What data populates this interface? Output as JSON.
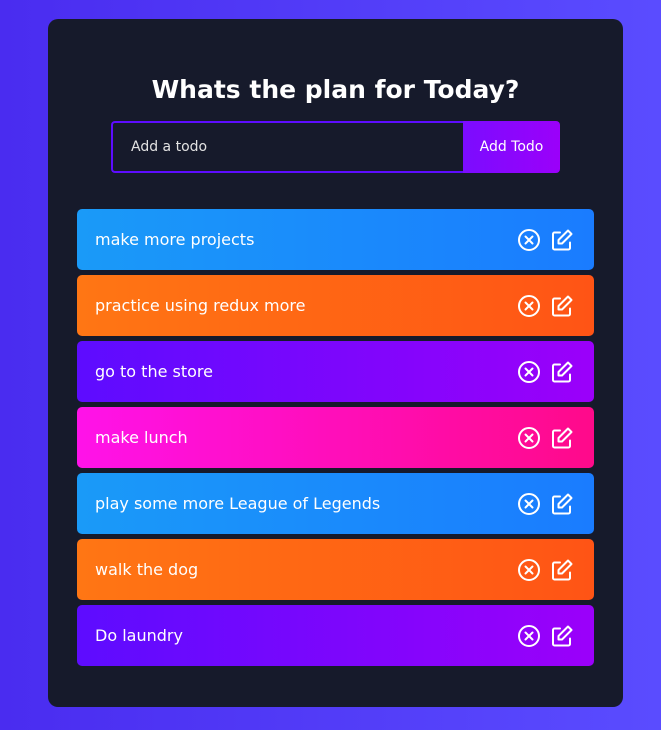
{
  "app": {
    "title": "Whats the plan for Today?"
  },
  "form": {
    "placeholder": "Add a todo",
    "value": "",
    "button_label": "Add Todo"
  },
  "icons": {
    "delete": "close-circle-icon",
    "edit": "edit-icon"
  },
  "colors": {
    "blue": "#1a9af8",
    "orange": "#ff7614",
    "purple": "#5d0cff",
    "pink": "#ff12e9",
    "panel": "#161a2b",
    "background": "#4a2cf0"
  },
  "todos": [
    {
      "text": "make more projects",
      "color": "blue"
    },
    {
      "text": "practice using redux more",
      "color": "orange"
    },
    {
      "text": "go to the store",
      "color": "purple"
    },
    {
      "text": "make lunch",
      "color": "pink"
    },
    {
      "text": "play some more League of Legends",
      "color": "blue"
    },
    {
      "text": "walk the dog",
      "color": "orange"
    },
    {
      "text": "Do laundry",
      "color": "purple"
    }
  ]
}
